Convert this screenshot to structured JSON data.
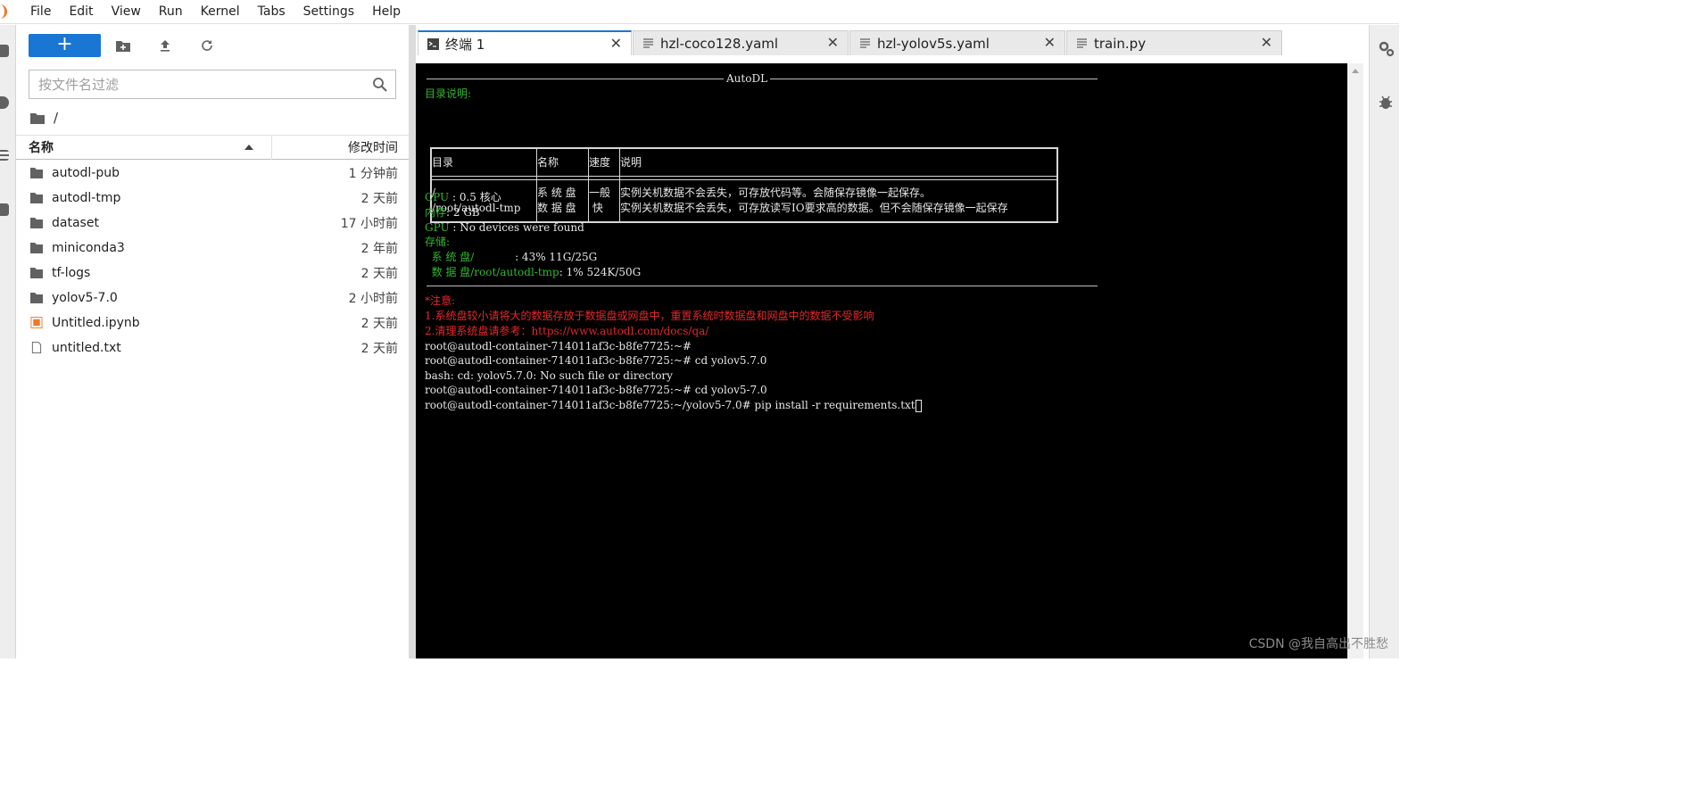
{
  "menubar": {
    "items": [
      "File",
      "Edit",
      "View",
      "Run",
      "Kernel",
      "Tabs",
      "Settings",
      "Help"
    ]
  },
  "filebrowser": {
    "new_button_label": "+",
    "search_placeholder": "按文件名过滤",
    "breadcrumb": "/",
    "header": {
      "name": "名称",
      "modified": "修改时间"
    },
    "files": [
      {
        "name": "autodl-pub",
        "modified": "1 分钟前",
        "type": "folder"
      },
      {
        "name": "autodl-tmp",
        "modified": "2 天前",
        "type": "folder"
      },
      {
        "name": "dataset",
        "modified": "17 小时前",
        "type": "folder"
      },
      {
        "name": "miniconda3",
        "modified": "2 年前",
        "type": "folder"
      },
      {
        "name": "tf-logs",
        "modified": "2 天前",
        "type": "folder"
      },
      {
        "name": "yolov5-7.0",
        "modified": "2 小时前",
        "type": "folder"
      },
      {
        "name": "Untitled.ipynb",
        "modified": "2 天前",
        "type": "notebook"
      },
      {
        "name": "untitled.txt",
        "modified": "2 天前",
        "type": "text"
      }
    ]
  },
  "tabs": [
    {
      "label": "终端 1",
      "icon": "terminal-icon",
      "active": true
    },
    {
      "label": "hzl-coco128.yaml",
      "icon": "text-file-icon",
      "active": false
    },
    {
      "label": "hzl-yolov5s.yaml",
      "icon": "text-file-icon",
      "active": false
    },
    {
      "label": "train.py",
      "icon": "text-file-icon",
      "active": false
    }
  ],
  "tab_close_glyph": "✕",
  "terminal": {
    "banner_title": "AutoDL",
    "dir_heading": "目录说明:",
    "table_headers": [
      "目录",
      "名称",
      "速度",
      "说明"
    ],
    "table_rows": [
      [
        "/",
        "系 统 盘",
        "一般",
        "实例关机数据不会丢失，可存放代码等。会随保存镜像一起保存。"
      ],
      [
        "/root/autodl-tmp",
        "数 据 盘",
        " 快 ",
        "实例关机数据不会丢失，可存放读写IO要求高的数据。但不会随保存镜像一起保存"
      ]
    ],
    "cpu_label": "CPU ",
    "cpu_value": ": 0.5 核心",
    "mem_label": "内存",
    "mem_value": ": 2 GB",
    "gpu_label": "GPU ",
    "gpu_value": ": No devices were found",
    "storage_label": "存储:",
    "sys_disk_label": "  系 统 盘/            ",
    "sys_disk_value": ": 43% 11G/25G",
    "data_disk_label": "  数 据 盘/root/autodl-tmp",
    "data_disk_value": ": 1% 524K/50G",
    "notice_title": "*注意:",
    "notice_1": "1.系统盘较小请将大的数据存放于数据盘或网盘中，重置系统时数据盘和网盘中的数据不受影响",
    "notice_2": "2.清理系统盘请参考：https://www.autodl.com/docs/qa/",
    "cmd_lines": [
      "root@autodl-container-714011af3c-b8fe7725:~#",
      "root@autodl-container-714011af3c-b8fe7725:~# cd yolov5.7.0",
      "bash: cd: yolov5.7.0: No such file or directory",
      "root@autodl-container-714011af3c-b8fe7725:~# cd yolov5-7.0"
    ],
    "current_line": "root@autodl-container-714011af3c-b8fe7725:~/yolov5-7.0# pip install -r requirements.txt"
  },
  "watermark": "CSDN @我自高出不胜愁",
  "colors": {
    "accent": "#1976d2",
    "terminal_green": "#2fb72f",
    "terminal_red": "#e5282a",
    "notebook_orange": "#f37626"
  }
}
